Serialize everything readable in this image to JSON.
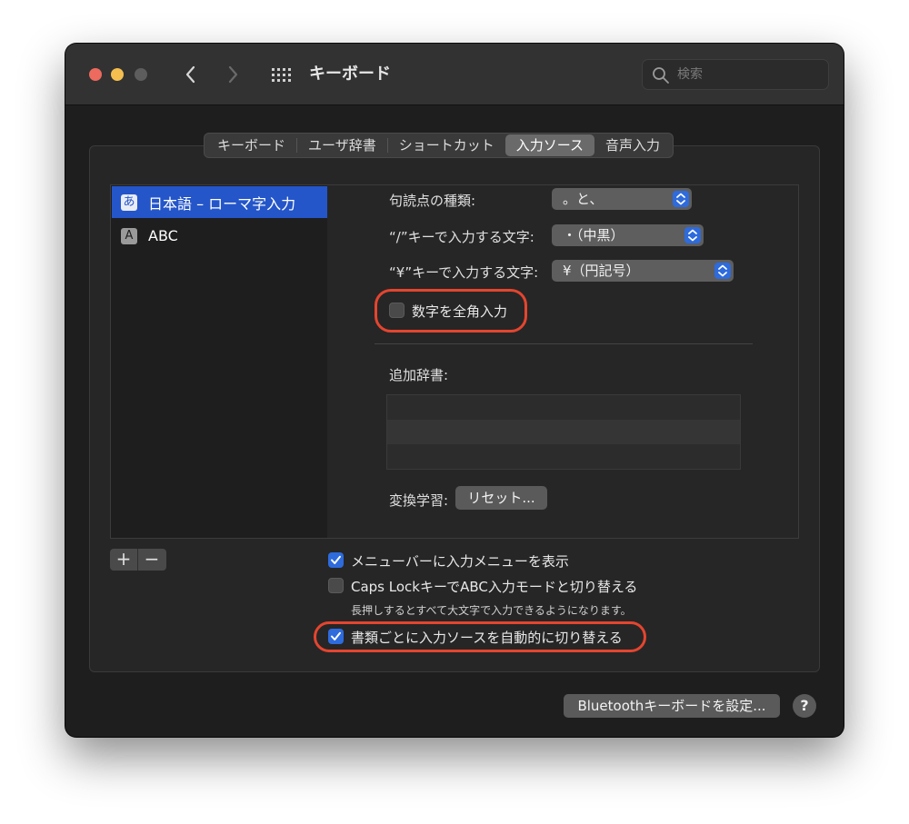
{
  "window": {
    "title": "キーボード"
  },
  "search": {
    "placeholder": "検索"
  },
  "tabs": [
    {
      "label": "キーボード"
    },
    {
      "label": "ユーザ辞書"
    },
    {
      "label": "ショートカット"
    },
    {
      "label": "入力ソース",
      "active": true
    },
    {
      "label": "音声入力"
    }
  ],
  "sources": [
    {
      "badge": "あ",
      "label": "日本語 – ローマ字入力",
      "selected": true
    },
    {
      "badge": "A",
      "label": "ABC",
      "selected": false
    }
  ],
  "settings": {
    "punct_label": "句読点の種類:",
    "punct_value": "。と、",
    "slash_label": "“/”キーで入力する文字:",
    "slash_value": "・（中黒）",
    "yen_label": "“¥”キーで入力する文字:",
    "yen_value": "¥（円記号）",
    "fullwidth_label": "数字を全角入力",
    "fullwidth_checked": false,
    "dict_label": "追加辞書:",
    "learning_label": "変換学習:",
    "reset_button": "リセット..."
  },
  "list_controls": {
    "add": "+",
    "remove": "−"
  },
  "options": {
    "show_menu_label": "メニューバーに入力メニューを表示",
    "show_menu_checked": true,
    "capslock_label": "Caps LockキーでABC入力モードと切り替える",
    "capslock_checked": false,
    "capslock_note": "長押しするとすべて大文字で入力できるようになります。",
    "auto_switch_label": "書類ごとに入力ソースを自動的に切り替える",
    "auto_switch_checked": true
  },
  "footer": {
    "bluetooth_button": "Bluetoothキーボードを設定...",
    "help": "?"
  },
  "colors": {
    "accent": "#2e6bdc",
    "selection": "#2456c9",
    "annotation": "#e4452f"
  }
}
